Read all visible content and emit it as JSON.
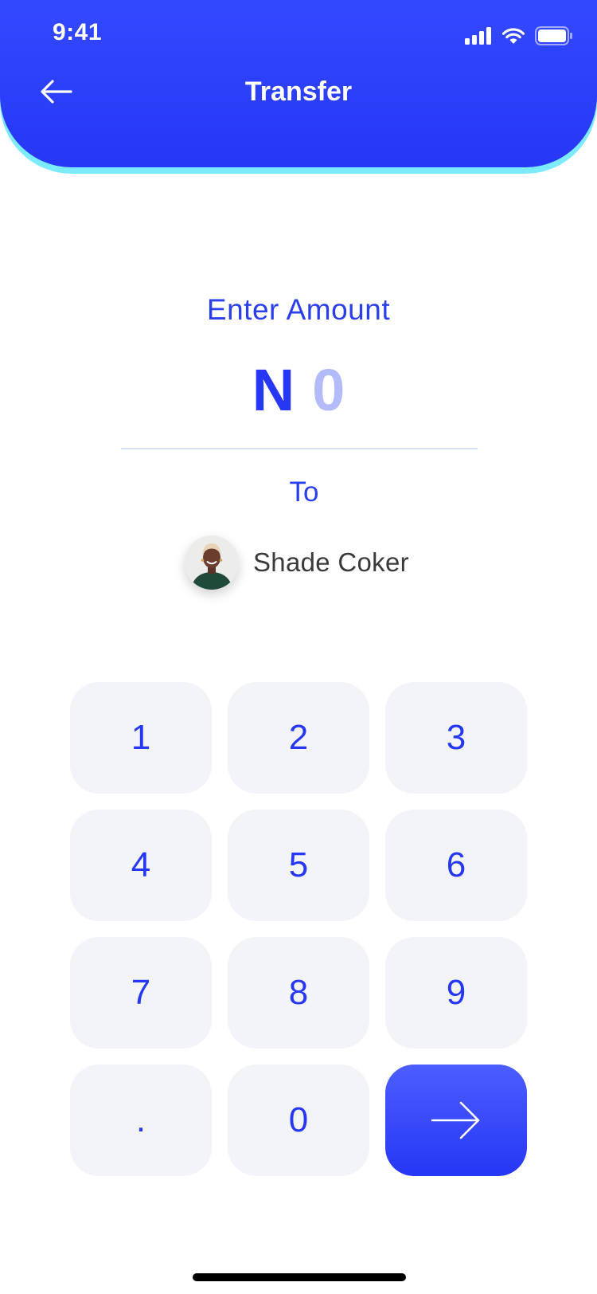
{
  "status_bar": {
    "time": "9:41"
  },
  "header": {
    "title": "Transfer",
    "back_icon": "arrow-left-icon"
  },
  "amount": {
    "prompt": "Enter Amount",
    "currency_symbol": "N",
    "value": "0"
  },
  "recipient": {
    "to_label": "To",
    "name": "Shade Coker"
  },
  "keypad": {
    "keys": [
      "1",
      "2",
      "3",
      "4",
      "5",
      "6",
      "7",
      "8",
      "9",
      ".",
      "0"
    ],
    "submit_icon": "arrow-right-icon"
  },
  "colors": {
    "primary": "#2637F5",
    "header_glow": "#7CEBFF",
    "amount_placeholder": "#B3BBFA",
    "key_background": "#F3F4F8"
  }
}
